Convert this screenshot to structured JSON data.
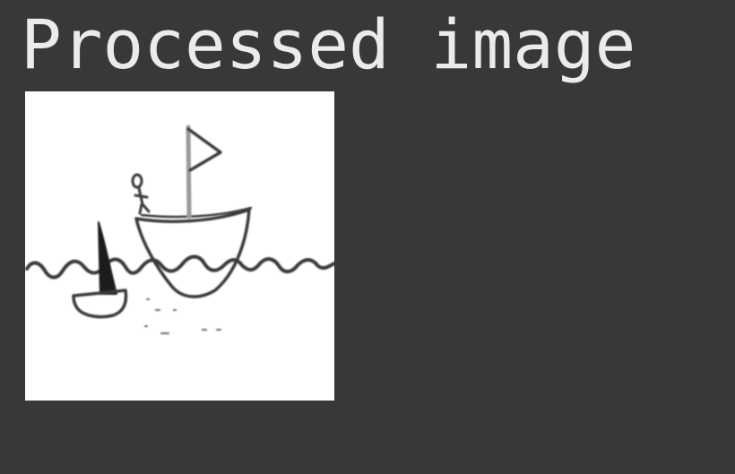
{
  "header": {
    "title": "Processed image"
  },
  "image": {
    "description_icon": "sailboat-drawing-icon",
    "background_color": "#ffffff",
    "stroke_color": "#3a3a3a"
  },
  "colors": {
    "page_background": "#383838",
    "title_text": "#ebebeb"
  }
}
